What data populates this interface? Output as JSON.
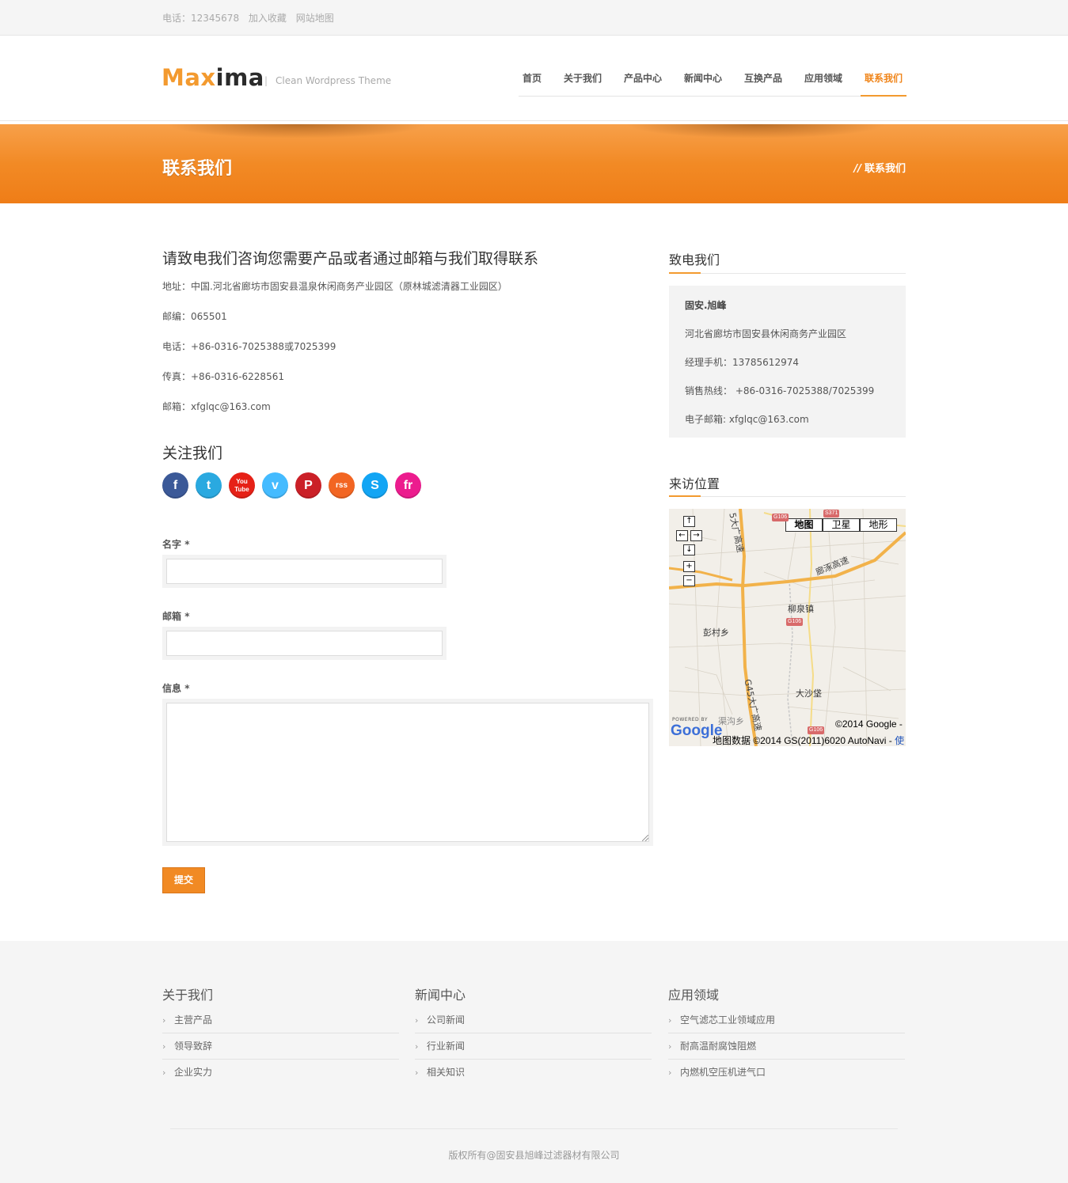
{
  "topbar": {
    "phone": "电话：12345678",
    "bookmark": "加入收藏",
    "sitemap": "网站地图"
  },
  "header": {
    "logo_orange": "Max",
    "logo_dark": "ima",
    "tagline_sep": "|",
    "tagline": "Clean Wordpress Theme",
    "nav": [
      {
        "label": "首页"
      },
      {
        "label": "关于我们"
      },
      {
        "label": "产品中心"
      },
      {
        "label": "新闻中心"
      },
      {
        "label": "互换产品"
      },
      {
        "label": "应用领域"
      },
      {
        "label": "联系我们",
        "active": true
      }
    ]
  },
  "banner": {
    "title": "联系我们",
    "breadcrumb_slashes": "//",
    "breadcrumb_current": "联系我们"
  },
  "contact": {
    "heading": "请致电我们咨询您需要产品或者通过邮箱与我们取得联系",
    "address": "地址：中国.河北省廊坊市固安县温泉休闲商务产业园区（原林城滤清器工业园区）",
    "postcode": "邮编：065501",
    "phone": "电话：+86-0316-7025388或7025399",
    "fax": "传真：+86-0316-6228561",
    "email": "邮箱：xfglqc@163.com"
  },
  "follow": {
    "heading": "关注我们",
    "icons": [
      {
        "name": "facebook-icon",
        "glyph": "f",
        "color": "#3b5998"
      },
      {
        "name": "twitter-icon",
        "glyph": "t",
        "color": "#2aa9e0"
      },
      {
        "name": "youtube-icon",
        "glyph": "You Tube",
        "color": "#e62117"
      },
      {
        "name": "vimeo-icon",
        "glyph": "v",
        "color": "#44bbff"
      },
      {
        "name": "pinterest-icon",
        "glyph": "P",
        "color": "#cb2027"
      },
      {
        "name": "rss-icon",
        "glyph": "rss",
        "color": "#f26522"
      },
      {
        "name": "skype-icon",
        "glyph": "S",
        "color": "#12a5f4"
      },
      {
        "name": "friendfeed-icon",
        "glyph": "fr",
        "color": "#ec1c8e"
      }
    ]
  },
  "form": {
    "name_label": "名字",
    "email_label": "邮箱",
    "message_label": "信息",
    "required_mark": "*",
    "name_value": "",
    "email_value": "",
    "message_value": "",
    "submit_label": "提交"
  },
  "sidebar": {
    "call_title": "致电我们",
    "company": "固安.旭峰",
    "address": "河北省廊坊市固安县休闲商务产业园区",
    "manager_phone": "经理手机：13785612974",
    "sales_hotline": "销售热线： +86-0316-7025388/7025399",
    "email": "电子邮箱: xfglqc@163.com",
    "map_title": "来访位置"
  },
  "map": {
    "type_buttons": [
      {
        "label": "地图",
        "selected": true
      },
      {
        "label": "卫星",
        "selected": false
      },
      {
        "label": "地形",
        "selected": false
      }
    ],
    "controls": {
      "up": "↑",
      "left": "←",
      "right": "→",
      "down": "↓",
      "zoom_in": "+",
      "zoom_out": "−"
    },
    "labels": {
      "liuquan": "柳泉镇",
      "pengcun": "彭村乡",
      "dashabao": "大沙垡",
      "qugou": "渠沟乡",
      "lianzhuo": "廊涿高速",
      "expressway_5": "5大广高速",
      "expressway_g45": "G45大广高速"
    },
    "shields": {
      "s371": "S371",
      "g106_top": "G106",
      "g106_mid": "G106",
      "g106_bottom": "G106"
    },
    "powered_by": "POWERED BY",
    "google": "Google",
    "copyright_line": "©2014 Google -",
    "data_line": "地图数据 ©2014 GS(2011)6020 AutoNavi -",
    "terms_link": "使"
  },
  "footer": {
    "columns": [
      {
        "title": "关于我们",
        "items": [
          "主营产品",
          "领导致辞",
          "企业实力"
        ]
      },
      {
        "title": "新闻中心",
        "items": [
          "公司新闻",
          "行业新闻",
          "相关知识"
        ]
      },
      {
        "title": "应用领域",
        "items": [
          "空气滤芯工业领域应用",
          "耐高温耐腐蚀阻燃",
          "内燃机空压机进气口"
        ]
      }
    ],
    "chevron": "›",
    "copyright": "版权所有@固安县旭峰过滤器材有限公司"
  }
}
